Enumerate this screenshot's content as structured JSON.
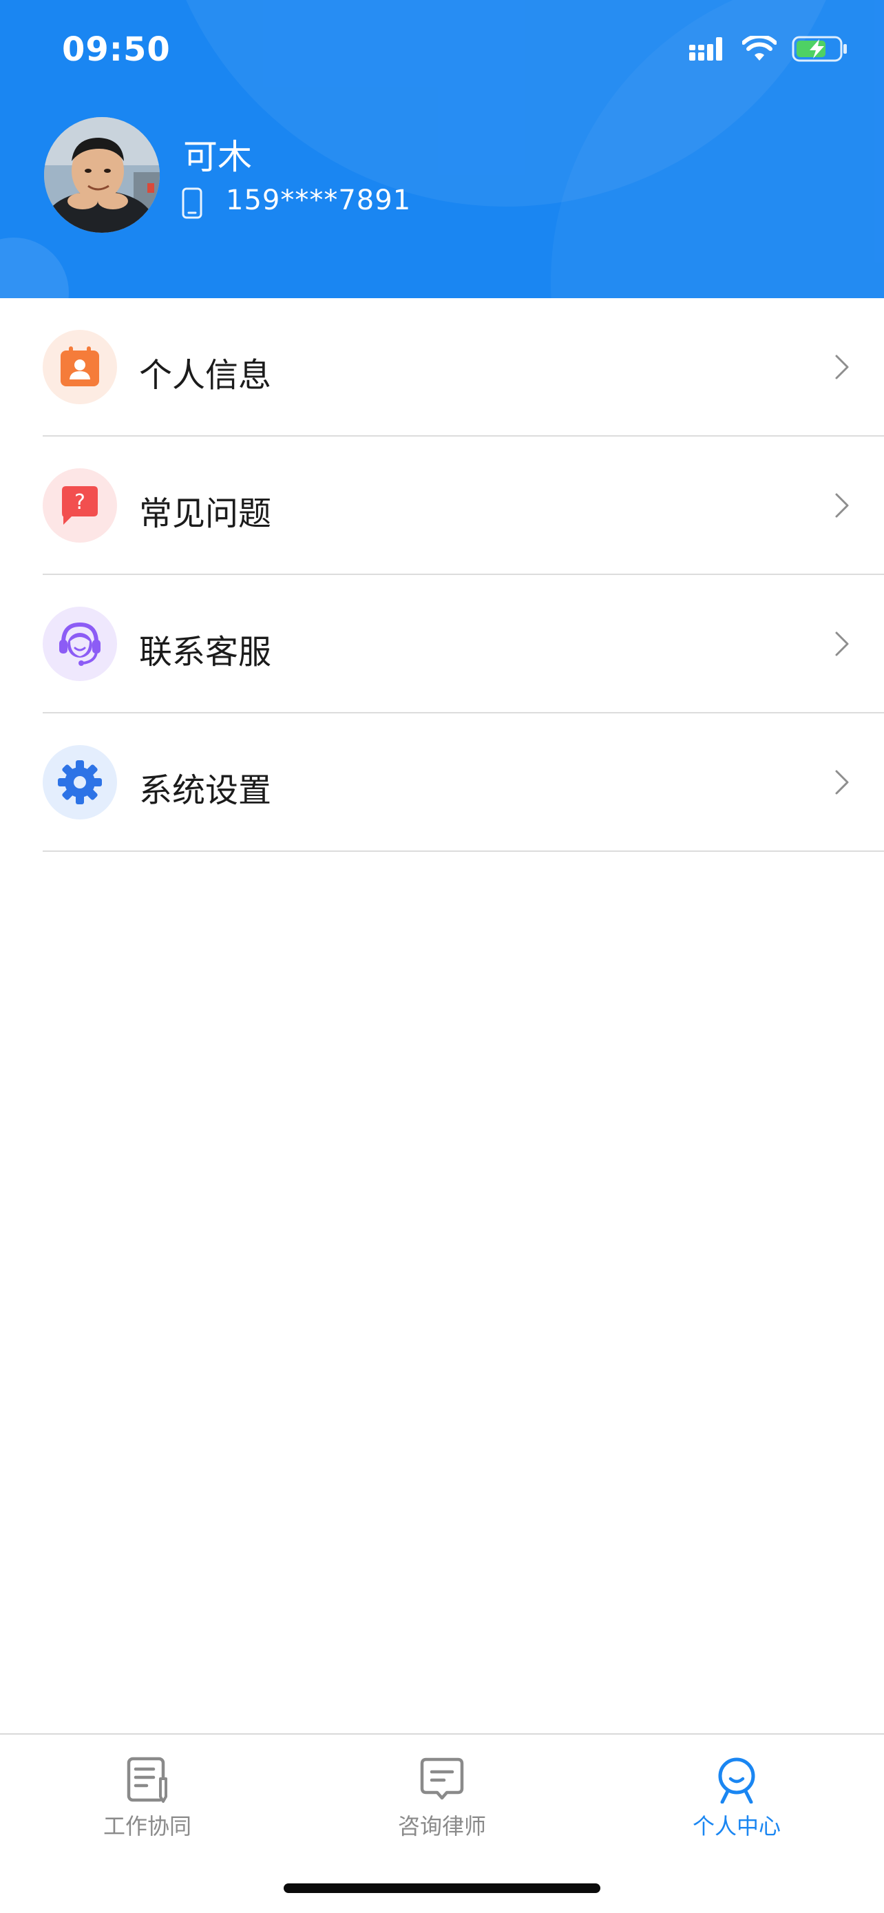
{
  "status_bar": {
    "time": "09:50"
  },
  "profile": {
    "name": "可木",
    "phone": "159****7891"
  },
  "menu": {
    "items": [
      {
        "label": "个人信息",
        "icon": "contact-card-icon",
        "color": "#f57c3a",
        "bg": "#fdece3"
      },
      {
        "label": "常见问题",
        "icon": "question-bubble-icon",
        "color": "#f24f4f",
        "bg": "#fde6e6"
      },
      {
        "label": "联系客服",
        "icon": "headset-agent-icon",
        "color": "#8c5cf5",
        "bg": "#efe8fd"
      },
      {
        "label": "系统设置",
        "icon": "gear-icon",
        "color": "#2d73e6",
        "bg": "#e4eefd"
      }
    ]
  },
  "tabbar": {
    "tabs": [
      {
        "label": "工作协同",
        "icon": "document-edit-icon",
        "active": false
      },
      {
        "label": "咨询律师",
        "icon": "message-icon",
        "active": false
      },
      {
        "label": "个人中心",
        "icon": "person-icon",
        "active": true
      }
    ]
  },
  "colors": {
    "brand": "#1a86f2",
    "text": "#1b1b1b",
    "inactive_tab": "#8a8a8a"
  }
}
